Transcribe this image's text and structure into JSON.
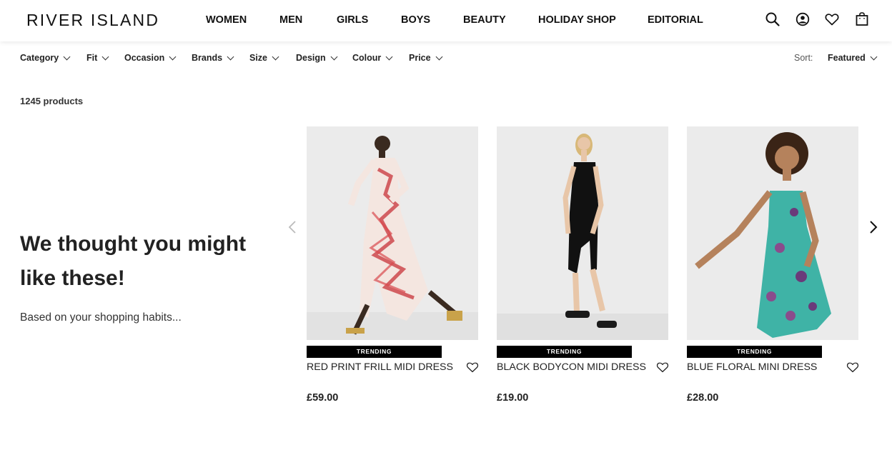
{
  "brand": {
    "logo_text": "RIVER ISLAND"
  },
  "nav": {
    "items": [
      "WOMEN",
      "MEN",
      "GIRLS",
      "BOYS",
      "BEAUTY",
      "HOLIDAY SHOP",
      "EDITORIAL"
    ]
  },
  "header_icons": [
    "search-icon",
    "account-icon",
    "wishlist-heart-icon",
    "bag-icon"
  ],
  "filters": {
    "items": [
      "Category",
      "Fit",
      "Occasion",
      "Brands",
      "Size",
      "Design",
      "Colour",
      "Price"
    ],
    "sort_label": "Sort:",
    "sort_value": "Featured"
  },
  "results": {
    "count_text": "1245 products"
  },
  "recommendations": {
    "title": "We thought you might like these!",
    "subtitle": "Based on your shopping habits...",
    "products": [
      {
        "badge": "TRENDING",
        "name": "RED PRINT FRILL MIDI DRESS",
        "price": "£59.00"
      },
      {
        "badge": "TRENDING",
        "name": "BLACK BODYCON MIDI DRESS",
        "price": "£19.00"
      },
      {
        "badge": "TRENDING",
        "name": "BLUE FLORAL MINI DRESS",
        "price": "£28.00"
      }
    ]
  },
  "colors": {
    "accent": "#000000",
    "text": "#1a1a1a",
    "card_bg": "#ebebeb"
  }
}
